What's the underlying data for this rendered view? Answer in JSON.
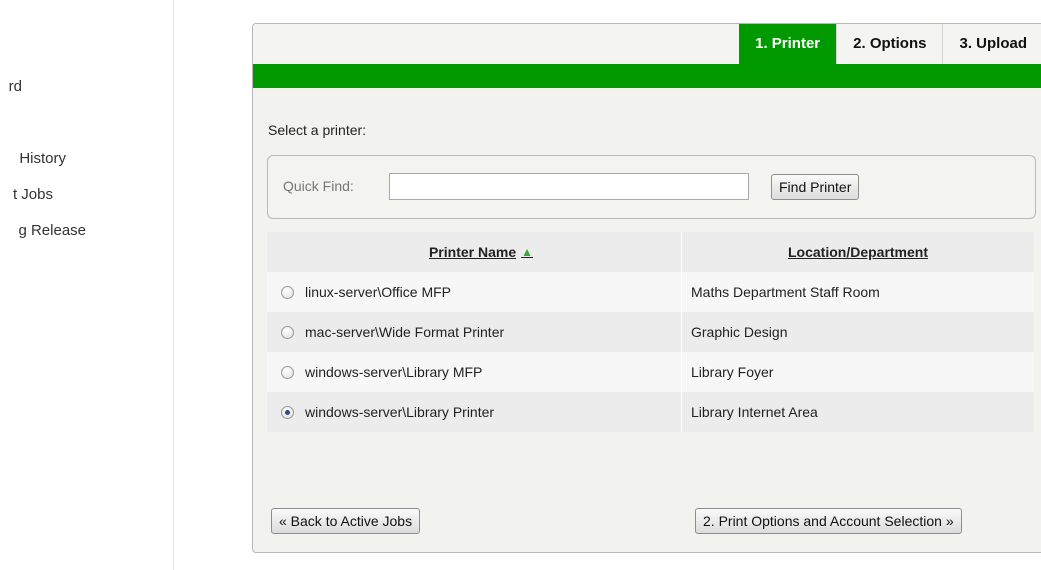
{
  "sidebar": {
    "items": [
      {
        "label": "rd"
      },
      {
        "label": "History"
      },
      {
        "label": "t Jobs"
      },
      {
        "label": "g Release"
      }
    ]
  },
  "tabs": [
    {
      "label": "1. Printer",
      "active": true
    },
    {
      "label": "2. Options",
      "active": false
    },
    {
      "label": "3. Upload",
      "active": false
    }
  ],
  "prompt": "Select a printer:",
  "quick_find": {
    "label": "Quick Find:",
    "value": "",
    "placeholder": "",
    "button_label": "Find Printer"
  },
  "table": {
    "headers": {
      "name": "Printer Name",
      "location": "Location/Department"
    },
    "sort_icon": "▲",
    "rows": [
      {
        "name": "linux-server\\Office MFP",
        "location": "Maths Department Staff Room",
        "selected": false
      },
      {
        "name": "mac-server\\Wide Format Printer",
        "location": "Graphic Design",
        "selected": false
      },
      {
        "name": "windows-server\\Library MFP",
        "location": "Library Foyer",
        "selected": false
      },
      {
        "name": "windows-server\\Library Printer",
        "location": "Library Internet Area",
        "selected": true
      }
    ]
  },
  "buttons": {
    "back": "« Back to Active Jobs",
    "next": "2. Print Options and Account Selection »"
  },
  "colors": {
    "accent": "#009a00",
    "sort_icon": "#3aa63a"
  }
}
